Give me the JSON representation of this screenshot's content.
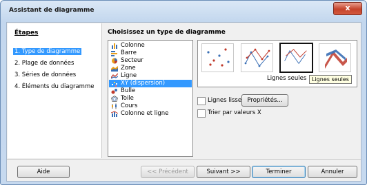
{
  "window": {
    "title": "Assistant de diagramme",
    "close_label": "x"
  },
  "steps": {
    "heading": "Étapes",
    "items": [
      {
        "label": "1. Type de diagramme",
        "selected": true
      },
      {
        "label": "2. Plage de données",
        "selected": false
      },
      {
        "label": "3. Séries de données",
        "selected": false
      },
      {
        "label": "4. Éléments du diagramme",
        "selected": false
      }
    ]
  },
  "chart_types": {
    "heading": "Choisissez un type de diagramme",
    "items": [
      {
        "label": "Colonne",
        "icon": "column-chart-icon"
      },
      {
        "label": "Barre",
        "icon": "bar-chart-icon"
      },
      {
        "label": "Secteur",
        "icon": "pie-chart-icon"
      },
      {
        "label": "Zone",
        "icon": "area-chart-icon"
      },
      {
        "label": "Ligne",
        "icon": "line-chart-icon"
      },
      {
        "label": "XY (dispersion)",
        "icon": "scatter-chart-icon",
        "selected": true
      },
      {
        "label": "Bulle",
        "icon": "bubble-chart-icon"
      },
      {
        "label": "Toile",
        "icon": "net-chart-icon"
      },
      {
        "label": "Cours",
        "icon": "stock-chart-icon"
      },
      {
        "label": "Colonne et ligne",
        "icon": "column-line-chart-icon"
      }
    ]
  },
  "variants": {
    "selected_label": "Lignes seules",
    "tooltip": "Lignes seules",
    "items": [
      "Points seuls",
      "Points et lignes",
      "Lignes seules",
      "Lignes 3D"
    ]
  },
  "options": {
    "smooth_lines": "Lignes lisses",
    "properties_button": "Propriétés...",
    "sort_by_x": "Trier par valeurs X"
  },
  "buttons": {
    "help": "Aide",
    "previous": "<< Précédent",
    "next": "Suivant >>",
    "finish": "Terminer",
    "cancel": "Annuler"
  },
  "colors": {
    "selection": "#3399ff",
    "tooltip_bg": "#ffffe1"
  }
}
